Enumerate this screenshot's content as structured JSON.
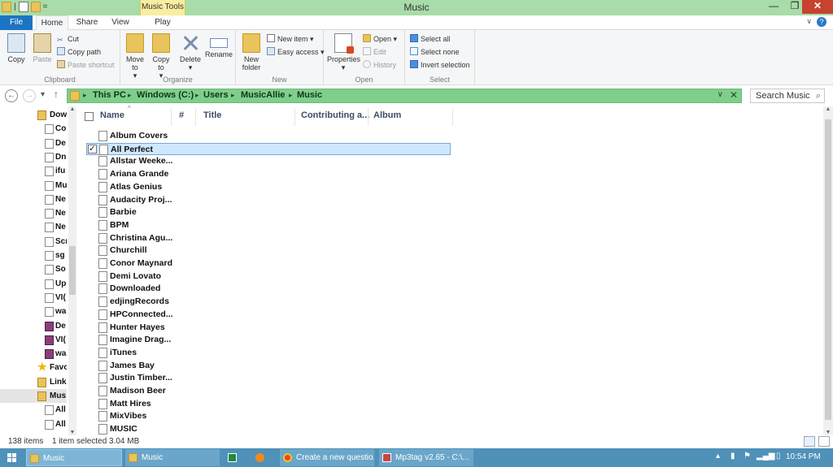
{
  "window": {
    "title": "Music",
    "context_tab": "Music Tools"
  },
  "tabs": {
    "file": "File",
    "home": "Home",
    "share": "Share",
    "view": "View",
    "play": "Play"
  },
  "ribbon": {
    "clipboard": {
      "label": "Clipboard",
      "copy": "Copy",
      "paste": "Paste",
      "cut": "Cut",
      "copy_path": "Copy path",
      "paste_shortcut": "Paste shortcut"
    },
    "organize": {
      "label": "Organize",
      "move_to": "Move to",
      "copy_to": "Copy to",
      "delete": "Delete",
      "rename": "Rename"
    },
    "new": {
      "label": "New",
      "new_folder": "New folder",
      "new_item": "New item",
      "easy_access": "Easy access"
    },
    "open": {
      "label": "Open",
      "properties": "Properties",
      "open": "Open",
      "edit": "Edit",
      "history": "History"
    },
    "select": {
      "label": "Select",
      "select_all": "Select all",
      "select_none": "Select none",
      "invert_selection": "Invert selection"
    }
  },
  "address": {
    "crumbs": [
      "This PC",
      "Windows (C:)",
      "Users",
      "MusicAllie",
      "Music"
    ],
    "search_placeholder": "Search Music"
  },
  "nav_pane": {
    "items": [
      {
        "label": "Dow",
        "icon": "folder-icon"
      },
      {
        "label": "Co",
        "icon": "file-icon"
      },
      {
        "label": "De",
        "icon": "file-icon"
      },
      {
        "label": "Dn",
        "icon": "file-icon"
      },
      {
        "label": "ifu",
        "icon": "file-icon"
      },
      {
        "label": "Mu",
        "icon": "file-icon"
      },
      {
        "label": "Ne",
        "icon": "file-icon"
      },
      {
        "label": "Ne",
        "icon": "file-icon"
      },
      {
        "label": "Ne",
        "icon": "file-icon"
      },
      {
        "label": "Scr",
        "icon": "file-icon"
      },
      {
        "label": "sg",
        "icon": "file-icon"
      },
      {
        "label": "So",
        "icon": "file-icon"
      },
      {
        "label": "Up",
        "icon": "file-icon"
      },
      {
        "label": "VI(",
        "icon": "file-icon"
      },
      {
        "label": "wa",
        "icon": "file-icon"
      },
      {
        "label": "De",
        "icon": "rar-icon"
      },
      {
        "label": "VI(",
        "icon": "rar-icon"
      },
      {
        "label": "wa",
        "icon": "rar-icon"
      },
      {
        "label": "Favo",
        "icon": "star-icon"
      },
      {
        "label": "Link",
        "icon": "folder-icon"
      },
      {
        "label": "Mus",
        "icon": "music-folder-icon"
      },
      {
        "label": "All",
        "icon": "file-icon"
      },
      {
        "label": "All",
        "icon": "file-icon"
      }
    ]
  },
  "file_list": {
    "columns": [
      "Name",
      "#",
      "Title",
      "Contributing a...",
      "Album"
    ],
    "rows": [
      {
        "name": "Album Covers",
        "checked": false
      },
      {
        "name": "All Perfect",
        "checked": true
      },
      {
        "name": "Allstar Weeke...",
        "checked": false
      },
      {
        "name": "Ariana Grande",
        "checked": false
      },
      {
        "name": "Atlas Genius",
        "checked": false
      },
      {
        "name": "Audacity Proj...",
        "checked": false
      },
      {
        "name": "Barbie",
        "checked": false
      },
      {
        "name": "BPM",
        "checked": false
      },
      {
        "name": "Christina Agu...",
        "checked": false
      },
      {
        "name": "Churchill",
        "checked": false
      },
      {
        "name": "Conor Maynard",
        "checked": false
      },
      {
        "name": "Demi Lovato",
        "checked": false
      },
      {
        "name": "Downloaded",
        "checked": false
      },
      {
        "name": "edjingRecords",
        "checked": false
      },
      {
        "name": "HPConnected...",
        "checked": false
      },
      {
        "name": "Hunter Hayes",
        "checked": false
      },
      {
        "name": "Imagine Drag...",
        "checked": false
      },
      {
        "name": "iTunes",
        "checked": false
      },
      {
        "name": "James Bay",
        "checked": false
      },
      {
        "name": "Justin Timber...",
        "checked": false
      },
      {
        "name": "Madison Beer",
        "checked": false
      },
      {
        "name": "Matt Hires",
        "checked": false
      },
      {
        "name": "MixVibes",
        "checked": false
      },
      {
        "name": "MUSIC",
        "checked": false
      }
    ]
  },
  "status": {
    "item_count": "138 items",
    "selection": "1 item selected  3.04 MB"
  },
  "taskbar": {
    "tasks": [
      {
        "label": "Music",
        "active": true
      },
      {
        "label": "Music",
        "active": false
      },
      {
        "label": "",
        "active": false
      },
      {
        "label": "",
        "active": false
      },
      {
        "label": "Create a new questio...",
        "active": false
      },
      {
        "label": "Mp3tag v2.65  -  C:\\...",
        "active": false
      }
    ],
    "time": "10:54 PM"
  }
}
